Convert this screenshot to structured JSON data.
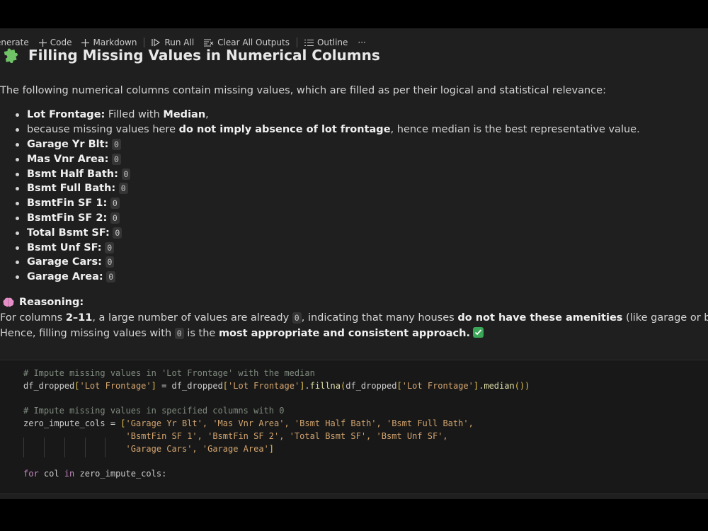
{
  "toolbar": {
    "generate_label": "enerate",
    "code_label": "Code",
    "markdown_label": "Markdown",
    "run_all_label": "Run All",
    "clear_outputs_label": "Clear All Outputs",
    "outline_label": "Outline",
    "more_label": "···"
  },
  "markdown": {
    "title": "Filling Missing Values in Numerical Columns",
    "intro": "The following numerical columns contain missing values, which are filled as per their logical and statistical relevance:",
    "first_item": {
      "label": "Lot Frontage:",
      "text1": " Filled with ",
      "bold1": "Median",
      "text2": ",",
      "line2_pre": "because missing values here ",
      "line2_bold": "do not imply absence of lot frontage",
      "line2_post": ", hence median is the best representative value."
    },
    "zero_items": [
      {
        "label": "Garage Yr Blt:",
        "value": "0"
      },
      {
        "label": "Mas Vnr Area:",
        "value": "0"
      },
      {
        "label": "Bsmt Half Bath:",
        "value": "0"
      },
      {
        "label": "Bsmt Full Bath:",
        "value": "0"
      },
      {
        "label": "BsmtFin SF 1:",
        "value": "0"
      },
      {
        "label": "BsmtFin SF 2:",
        "value": "0"
      },
      {
        "label": "Total Bsmt SF:",
        "value": "0"
      },
      {
        "label": "Bsmt Unf SF:",
        "value": "0"
      },
      {
        "label": "Garage Cars:",
        "value": "0"
      },
      {
        "label": "Garage Area:",
        "value": "0"
      }
    ],
    "reasoning_heading": "Reasoning:",
    "reasoning_line1": {
      "pre": "For columns ",
      "bold1": "2–11",
      "mid1": ", a large number of values are already ",
      "code": "0",
      "mid2": ", indicating that many houses ",
      "bold2": "do not have these amenities",
      "post": " (like garage or basement)."
    },
    "reasoning_line2": {
      "pre": "Hence, filling missing values with ",
      "code": "0",
      "mid": " is the ",
      "bold": "most appropriate and consistent approach."
    }
  },
  "code_cell": {
    "comment1": "# Impute missing values in 'Lot Frontage' with the median",
    "line2": {
      "a": "df_dropped",
      "b": "[",
      "c": "'Lot Frontage'",
      "d": "]",
      "e": " = df_dropped",
      "f": "[",
      "g": "'Lot Frontage'",
      "h": "]",
      "i": ".",
      "j": "fillna",
      "k": "(",
      "l": "df_dropped",
      "m": "[",
      "n": "'Lot Frontage'",
      "o": "]",
      "p": ".",
      "q": "median",
      "r": "())"
    },
    "comment2": "# Impute missing values in specified columns with 0",
    "line5_var": "zero_impute_cols = ",
    "line5_open": "[",
    "line5_strs": "'Garage Yr Blt', 'Mas Vnr Area', 'Bsmt Half Bath', 'Bsmt Full Bath',",
    "line6_strs": "'BsmtFin SF 1', 'BsmtFin SF 2', 'Total Bsmt SF', 'Bsmt Unf SF',",
    "line7_strs": "'Garage Cars', 'Garage Area'",
    "line7_close": "]",
    "line9_kw1": "for",
    "line9_var": " col ",
    "line9_kw2": "in",
    "line9_rest": " zero_impute_cols:"
  }
}
